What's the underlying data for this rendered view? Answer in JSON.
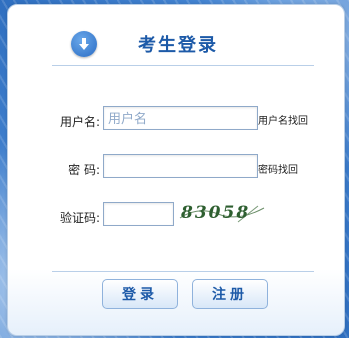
{
  "title": "考生登录",
  "fields": {
    "username": {
      "label": "用户名:",
      "placeholder": "用户名",
      "link": "用户名找回"
    },
    "password": {
      "label": "密 码:",
      "placeholder": "",
      "link": "密码找回"
    },
    "captcha": {
      "label": "验证码:",
      "code": "83058"
    }
  },
  "buttons": {
    "login": "登录",
    "register": "注册"
  },
  "colors": {
    "accent": "#1d5aa8",
    "background": "#2f6fc0",
    "captcha": "#2e5f30"
  },
  "icons": {
    "title_icon": "download-arrow-icon"
  }
}
